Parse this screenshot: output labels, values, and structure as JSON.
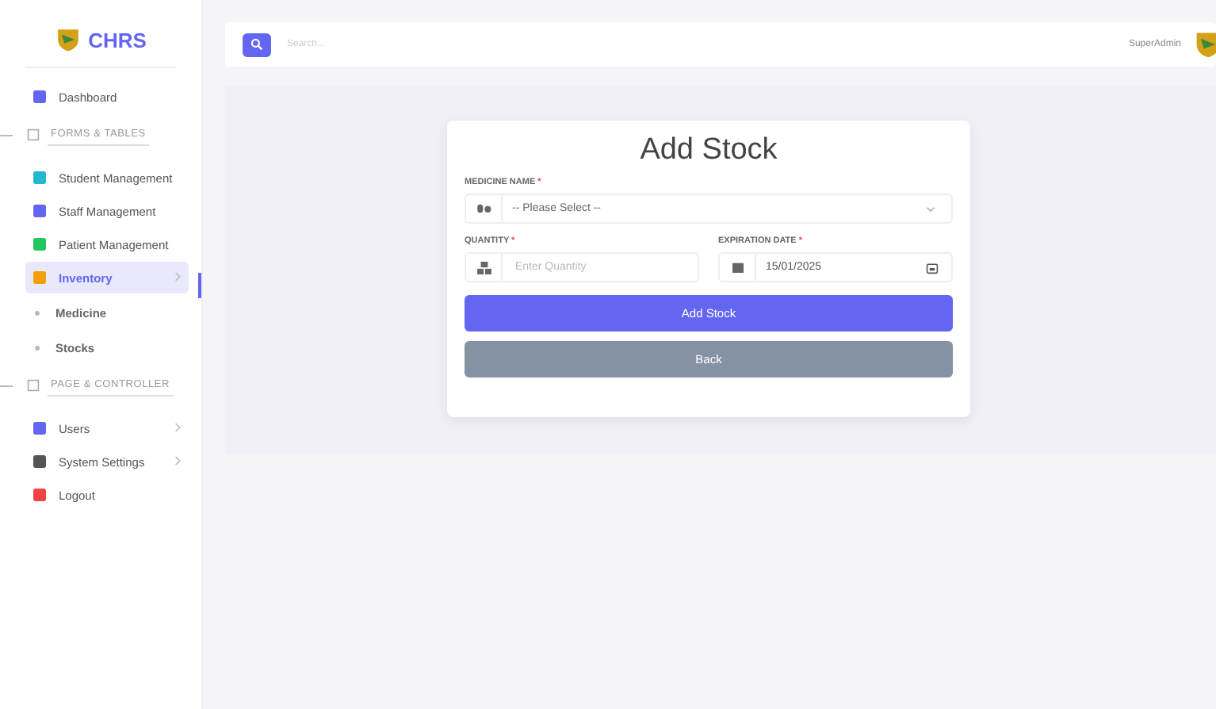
{
  "brand": {
    "name": "CHRS"
  },
  "sidebar": {
    "items": [
      {
        "kind": "item",
        "label": "Dashboard",
        "selected": false,
        "expandable": false
      },
      {
        "kind": "section",
        "label": "FORMS & TABLES"
      },
      {
        "kind": "item",
        "label": "Student Management",
        "selected": false,
        "expandable": false
      },
      {
        "kind": "item",
        "label": "Staff Management",
        "selected": false,
        "expandable": false
      },
      {
        "kind": "item",
        "label": "Patient Management",
        "selected": false,
        "expandable": false
      },
      {
        "kind": "item",
        "label": "Inventory",
        "selected": true,
        "expandable": true
      },
      {
        "kind": "subitem",
        "label": "Medicine",
        "selected": false
      },
      {
        "kind": "subitem",
        "label": "Stocks",
        "selected": false
      },
      {
        "kind": "section",
        "label": "PAGE & CONTROLLER"
      },
      {
        "kind": "item",
        "label": "Users",
        "selected": false,
        "expandable": true
      },
      {
        "kind": "item",
        "label": "System Settings",
        "selected": false,
        "expandable": true
      },
      {
        "kind": "item",
        "label": "Logout",
        "selected": false,
        "expandable": false
      }
    ]
  },
  "topbar": {
    "search_placeholder": "Search...",
    "user": "SuperAdmin"
  },
  "form": {
    "title": "Add Stock",
    "medicine": {
      "label": "MEDICINE NAME",
      "required_mark": "*",
      "value": "-- Please Select --"
    },
    "quantity": {
      "label": "QUANTITY",
      "required_mark": "*",
      "placeholder": "Enter Quantity"
    },
    "expiration": {
      "label": "EXPIRATION DATE",
      "required_mark": "*",
      "value": "15/01/2025"
    },
    "submit": "Add Stock",
    "back": "Back"
  }
}
